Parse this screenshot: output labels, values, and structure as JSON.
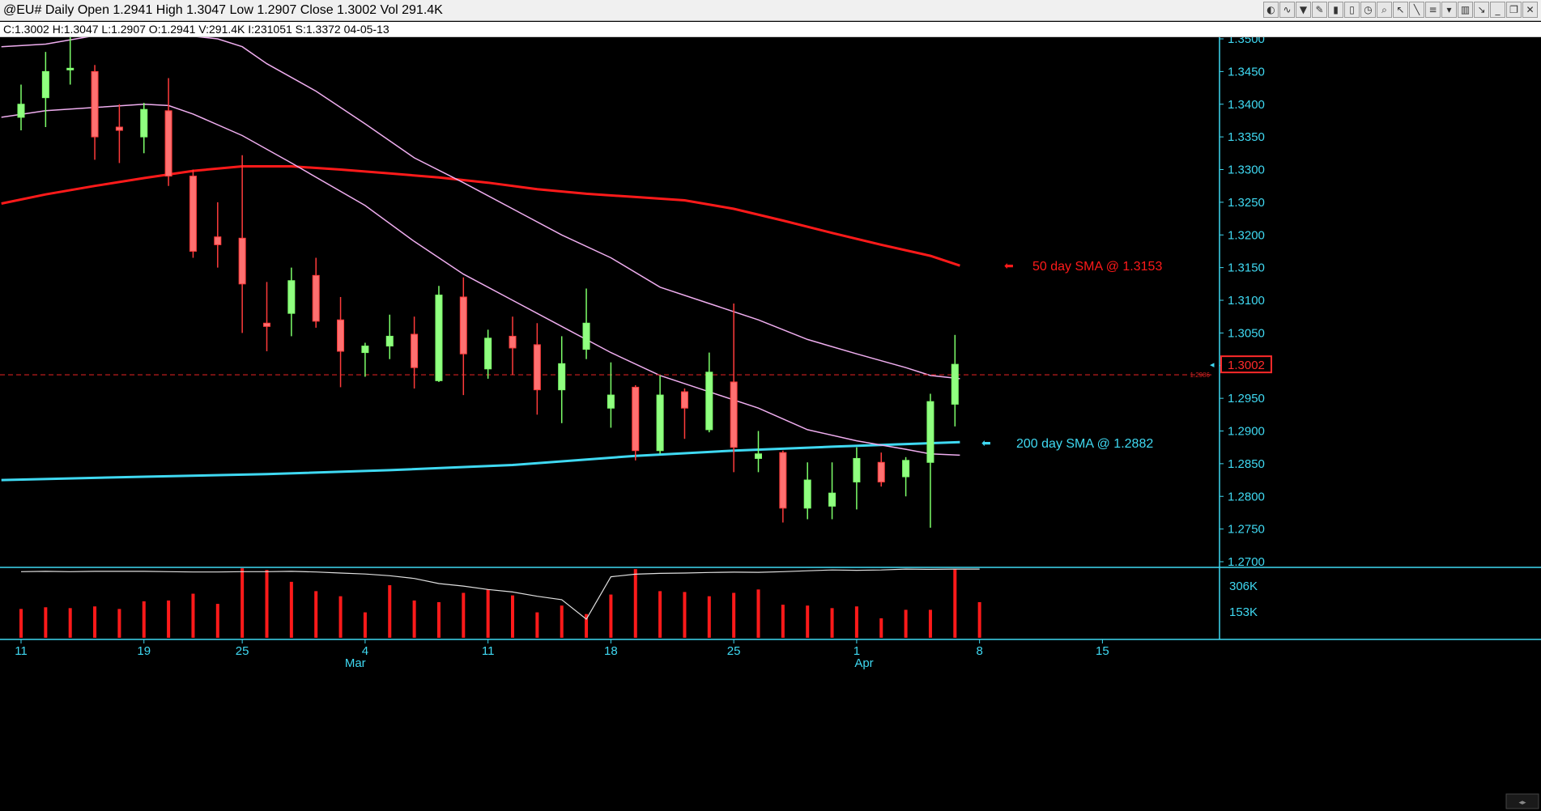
{
  "window": {
    "title": "@EU# Daily Open 1.2941 High 1.3047 Low 1.2907 Close 1.3002 Vol 291.4K",
    "info": "C:1.3002  H:1.3047  L:1.2907  O:1.2941  V:291.4K  I:231051  S:1.3372  04-05-13"
  },
  "toolbar": [
    "palette-icon",
    "trend-icon",
    "filter-icon",
    "pencil-icon",
    "barchart-icon",
    "bars-icon",
    "clock-icon",
    "zoom-icon",
    "cursor-icon",
    "draw-icon",
    "list-icon",
    "marker-icon",
    "trash-icon",
    "pointer-icon",
    "minimize-icon",
    "restore-icon",
    "close-icon"
  ],
  "chart_data": {
    "type": "candlestick",
    "price_axis": {
      "min": 1.27,
      "max": 1.35,
      "ticks": [
        "1.3500",
        "1.3450",
        "1.3400",
        "1.3350",
        "1.3300",
        "1.3250",
        "1.3200",
        "1.3150",
        "1.3100",
        "1.3050",
        "1.3000",
        "1.2950",
        "1.2900",
        "1.2850",
        "1.2800",
        "1.2750",
        "1.2700"
      ]
    },
    "last_price_label": "1.3002",
    "reference_line": {
      "value": 1.2986,
      "label": "1.2986",
      "color": "#ff2a2a"
    },
    "volume_axis": {
      "max": 420,
      "ticks": [
        {
          "value": 306,
          "label": "306K"
        },
        {
          "value": 153,
          "label": "153K"
        }
      ]
    },
    "date_axis": {
      "day_labels": [
        {
          "slot": 0,
          "label": "11"
        },
        {
          "slot": 5,
          "label": "19"
        },
        {
          "slot": 9,
          "label": "25"
        },
        {
          "slot": 14,
          "label": "4"
        },
        {
          "slot": 19,
          "label": "11"
        },
        {
          "slot": 24,
          "label": "18"
        },
        {
          "slot": 29,
          "label": "25"
        },
        {
          "slot": 34,
          "label": "1"
        },
        {
          "slot": 39,
          "label": "8"
        },
        {
          "slot": 44,
          "label": "15"
        }
      ],
      "month_labels": [
        {
          "slot": 13.6,
          "label": "Mar"
        },
        {
          "slot": 34.3,
          "label": "Apr"
        }
      ]
    },
    "candles": [
      {
        "o": 1.338,
        "h": 1.343,
        "l": 1.336,
        "c": 1.34
      },
      {
        "o": 1.341,
        "h": 1.348,
        "l": 1.3365,
        "c": 1.345
      },
      {
        "o": 1.3455,
        "h": 1.351,
        "l": 1.343,
        "c": 1.3455
      },
      {
        "o": 1.345,
        "h": 1.346,
        "l": 1.3315,
        "c": 1.335
      },
      {
        "o": 1.3365,
        "h": 1.34,
        "l": 1.331,
        "c": 1.336
      },
      {
        "o": 1.335,
        "h": 1.3402,
        "l": 1.3325,
        "c": 1.3392
      },
      {
        "o": 1.339,
        "h": 1.344,
        "l": 1.3275,
        "c": 1.329
      },
      {
        "o": 1.329,
        "h": 1.33,
        "l": 1.3165,
        "c": 1.3175
      },
      {
        "o": 1.3197,
        "h": 1.325,
        "l": 1.315,
        "c": 1.3185
      },
      {
        "o": 1.3195,
        "h": 1.3322,
        "l": 1.305,
        "c": 1.3125
      },
      {
        "o": 1.3065,
        "h": 1.3128,
        "l": 1.3022,
        "c": 1.306
      },
      {
        "o": 1.308,
        "h": 1.315,
        "l": 1.3045,
        "c": 1.313
      },
      {
        "o": 1.3138,
        "h": 1.3165,
        "l": 1.3058,
        "c": 1.3068
      },
      {
        "o": 1.307,
        "h": 1.3105,
        "l": 1.2967,
        "c": 1.3022
      },
      {
        "o": 1.302,
        "h": 1.3035,
        "l": 1.2983,
        "c": 1.303
      },
      {
        "o": 1.303,
        "h": 1.3078,
        "l": 1.301,
        "c": 1.3045
      },
      {
        "o": 1.3048,
        "h": 1.3075,
        "l": 1.2965,
        "c": 1.2997
      },
      {
        "o": 1.2977,
        "h": 1.3122,
        "l": 1.2975,
        "c": 1.3108
      },
      {
        "o": 1.3105,
        "h": 1.3135,
        "l": 1.2955,
        "c": 1.3018
      },
      {
        "o": 1.2995,
        "h": 1.3055,
        "l": 1.298,
        "c": 1.3042
      },
      {
        "o": 1.3045,
        "h": 1.3075,
        "l": 1.2986,
        "c": 1.3027
      },
      {
        "o": 1.3032,
        "h": 1.3065,
        "l": 1.2925,
        "c": 1.2963
      },
      {
        "o": 1.2963,
        "h": 1.3045,
        "l": 1.2912,
        "c": 1.3003
      },
      {
        "o": 1.3025,
        "h": 1.3118,
        "l": 1.301,
        "c": 1.3065
      },
      {
        "o": 1.2935,
        "h": 1.3005,
        "l": 1.2905,
        "c": 1.2955
      },
      {
        "o": 1.2967,
        "h": 1.297,
        "l": 1.2855,
        "c": 1.287
      },
      {
        "o": 1.287,
        "h": 1.2985,
        "l": 1.2865,
        "c": 1.2955
      },
      {
        "o": 1.296,
        "h": 1.2965,
        "l": 1.2888,
        "c": 1.2935
      },
      {
        "o": 1.2902,
        "h": 1.302,
        "l": 1.2898,
        "c": 1.299
      },
      {
        "o": 1.2975,
        "h": 1.3095,
        "l": 1.2837,
        "c": 1.2875
      },
      {
        "o": 1.2858,
        "h": 1.29,
        "l": 1.2837,
        "c": 1.2865
      },
      {
        "o": 1.2867,
        "h": 1.287,
        "l": 1.276,
        "c": 1.2782
      },
      {
        "o": 1.2782,
        "h": 1.2852,
        "l": 1.2765,
        "c": 1.2825
      },
      {
        "o": 1.2785,
        "h": 1.2852,
        "l": 1.2765,
        "c": 1.2805
      },
      {
        "o": 1.2822,
        "h": 1.2875,
        "l": 1.278,
        "c": 1.2858
      },
      {
        "o": 1.2852,
        "h": 1.2867,
        "l": 1.2815,
        "c": 1.2822
      },
      {
        "o": 1.283,
        "h": 1.286,
        "l": 1.28,
        "c": 1.2855
      },
      {
        "o": 1.2852,
        "h": 1.2957,
        "l": 1.2752,
        "c": 1.2945
      },
      {
        "o": 1.2941,
        "h": 1.3047,
        "l": 1.2907,
        "c": 1.3002
      }
    ],
    "volume": [
      170,
      180,
      175,
      185,
      170,
      215,
      220,
      260,
      200,
      410,
      400,
      330,
      275,
      245,
      150,
      310,
      220,
      210,
      265,
      285,
      250,
      150,
      190,
      140,
      255,
      405,
      275,
      270,
      245,
      265,
      285,
      195,
      190,
      175,
      185,
      115,
      165,
      165,
      405,
      210
    ],
    "volume_average": [
      390,
      392,
      390,
      392,
      392,
      392,
      390,
      388,
      388,
      390,
      390,
      392,
      388,
      382,
      376,
      366,
      350,
      320,
      305,
      285,
      270,
      245,
      225,
      110,
      360,
      375,
      380,
      382,
      385,
      387,
      386,
      390,
      395,
      400,
      398,
      400,
      405,
      404,
      405,
      405
    ],
    "overlays": [
      {
        "name": "50 day SMA",
        "label": "50 day SMA @ 1.3153",
        "color": "#ff1a1a",
        "width": 3,
        "points": [
          [
            -0.8,
            1.3248
          ],
          [
            1,
            1.3262
          ],
          [
            3,
            1.3275
          ],
          [
            5,
            1.3287
          ],
          [
            7,
            1.3298
          ],
          [
            9,
            1.3305
          ],
          [
            11,
            1.3305
          ],
          [
            13,
            1.33
          ],
          [
            15,
            1.3294
          ],
          [
            17,
            1.3288
          ],
          [
            19,
            1.328
          ],
          [
            21,
            1.327
          ],
          [
            23,
            1.3263
          ],
          [
            25,
            1.3258
          ],
          [
            27,
            1.3253
          ],
          [
            29,
            1.324
          ],
          [
            31,
            1.3222
          ],
          [
            33,
            1.3203
          ],
          [
            35,
            1.3185
          ],
          [
            37,
            1.3168
          ],
          [
            38.2,
            1.3153
          ]
        ]
      },
      {
        "name": "200 day SMA",
        "label": "200 day SMA @ 1.2882",
        "color": "#3fd9f2",
        "width": 3,
        "points": [
          [
            -0.8,
            1.2825
          ],
          [
            5,
            1.283
          ],
          [
            10,
            1.2834
          ],
          [
            15,
            1.284
          ],
          [
            20,
            1.2848
          ],
          [
            25,
            1.2862
          ],
          [
            29,
            1.287
          ],
          [
            33,
            1.2876
          ],
          [
            38.2,
            1.2883
          ]
        ]
      },
      {
        "name": "band-upper",
        "color": "#f0aef0",
        "width": 1.5,
        "points": [
          [
            -0.8,
            1.3488
          ],
          [
            1,
            1.3492
          ],
          [
            3,
            1.3505
          ],
          [
            6,
            1.3508
          ],
          [
            8,
            1.35
          ],
          [
            9,
            1.3488
          ],
          [
            10,
            1.3462
          ],
          [
            12,
            1.342
          ],
          [
            14,
            1.337
          ],
          [
            16,
            1.3318
          ],
          [
            18,
            1.328
          ],
          [
            20,
            1.324
          ],
          [
            22,
            1.32
          ],
          [
            24,
            1.3165
          ],
          [
            26,
            1.312
          ],
          [
            28,
            1.3095
          ],
          [
            30,
            1.307
          ],
          [
            32,
            1.304
          ],
          [
            34,
            1.3018
          ],
          [
            36,
            1.2997
          ],
          [
            37,
            1.2985
          ],
          [
            38.2,
            1.298
          ]
        ]
      },
      {
        "name": "band-lower",
        "color": "#f0aef0",
        "width": 1.5,
        "points": [
          [
            -0.8,
            1.338
          ],
          [
            1,
            1.339
          ],
          [
            3,
            1.3395
          ],
          [
            5,
            1.34
          ],
          [
            6,
            1.3398
          ],
          [
            7,
            1.3385
          ],
          [
            9,
            1.3352
          ],
          [
            11,
            1.331
          ],
          [
            14,
            1.3245
          ],
          [
            16,
            1.319
          ],
          [
            18,
            1.314
          ],
          [
            20,
            1.31
          ],
          [
            22,
            1.306
          ],
          [
            24,
            1.302
          ],
          [
            26,
            1.2985
          ],
          [
            28,
            1.296
          ],
          [
            30,
            1.2935
          ],
          [
            32,
            1.2902
          ],
          [
            34,
            1.2885
          ],
          [
            36,
            1.2872
          ],
          [
            37,
            1.2865
          ],
          [
            38.2,
            1.2863
          ]
        ]
      }
    ]
  }
}
